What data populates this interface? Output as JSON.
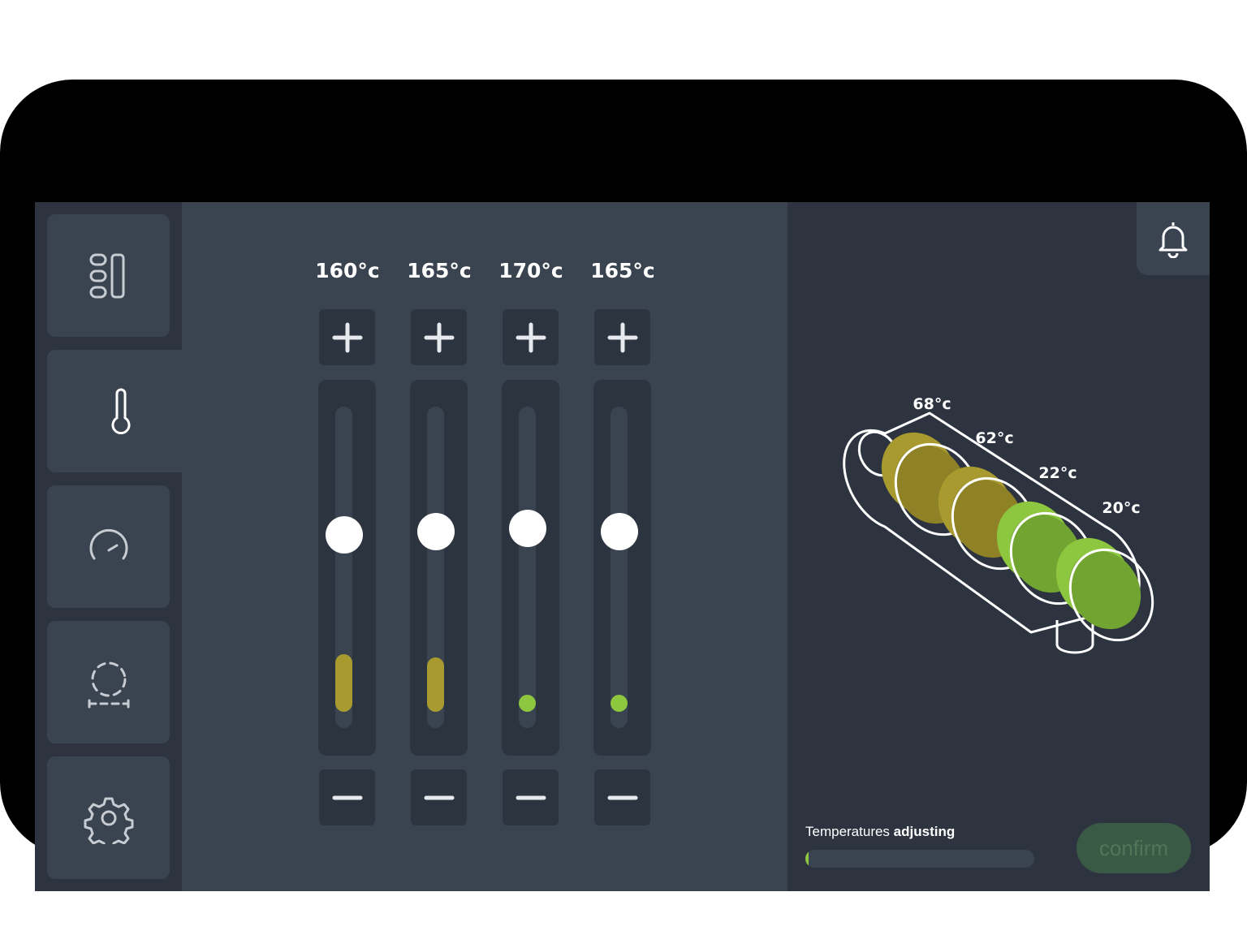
{
  "sidebar": {
    "items": [
      {
        "name": "dashboard",
        "icon": "layout-panels-icon",
        "active": false
      },
      {
        "name": "temperature",
        "icon": "thermometer-icon",
        "active": true
      },
      {
        "name": "speed",
        "icon": "gauge-icon",
        "active": false
      },
      {
        "name": "dimensions",
        "icon": "dashed-circle-measure-icon",
        "active": false
      },
      {
        "name": "settings",
        "icon": "gear-icon",
        "active": false
      }
    ]
  },
  "zones": [
    {
      "target": "160°c",
      "setpoint_fraction": 0.6,
      "current_fraction": 0.18,
      "level_color": "#a89a2e"
    },
    {
      "target": "165°c",
      "setpoint_fraction": 0.61,
      "current_fraction": 0.17,
      "level_color": "#a89a2e"
    },
    {
      "target": "170°c",
      "setpoint_fraction": 0.62,
      "current_fraction": 0.05,
      "level_color": "#8dc63f"
    },
    {
      "target": "165°c",
      "setpoint_fraction": 0.61,
      "current_fraction": 0.05,
      "level_color": "#8dc63f"
    }
  ],
  "barrel": {
    "zone_readings": [
      "68°c",
      "62°c",
      "22°c",
      "20°c"
    ],
    "colors": {
      "hot": "#a89a2e",
      "cool": "#8dc63f"
    }
  },
  "status": {
    "label": "Temperatures",
    "state": "adjusting",
    "progress_fraction": 0.015
  },
  "confirm_label": "confirm",
  "icons": {
    "increase": "plus-icon",
    "decrease": "minus-icon",
    "alerts": "bell-icon"
  }
}
